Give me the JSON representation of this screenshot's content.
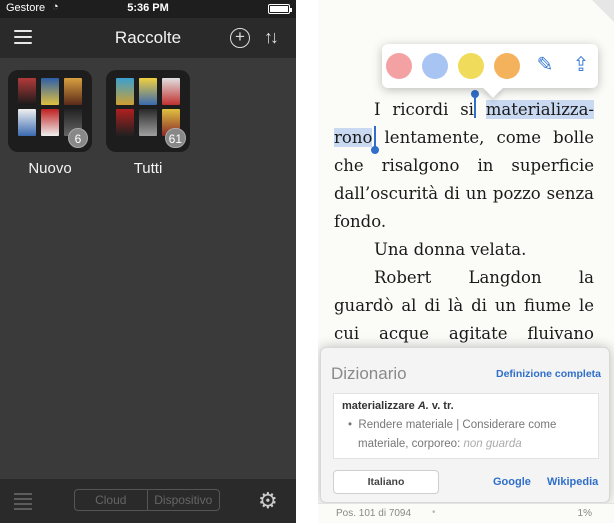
{
  "left": {
    "status": {
      "carrier": "Gestore",
      "time": "5:36 PM"
    },
    "nav": {
      "title": "Raccolte"
    },
    "collections": [
      {
        "label": "Nuovo",
        "count": "6"
      },
      {
        "label": "Tutti",
        "count": "61"
      }
    ],
    "bottom": {
      "segments": [
        "Cloud",
        "Dispositivo"
      ]
    },
    "colors": {
      "background": "#3a3a3a",
      "bars": "#2a2a2a",
      "tile": "#1d1d1d"
    }
  },
  "right": {
    "popup": {
      "swatches": [
        "#f4a1a3",
        "#a7c4f2",
        "#f0dc5a",
        "#f4b25c"
      ],
      "icons": [
        "edit-note-icon",
        "share-icon"
      ]
    },
    "text": {
      "p1_before": "I ricordi si ",
      "p1_hl_a": "materializza-",
      "p1_hl_b": "rono",
      "p1_after": " lentamente, come bolle che risalgono in superficie dall’oscurità di un pozzo senza fondo.",
      "p2": "Una donna velata.",
      "p3": "Robert Langdon la guardò al di là di un fiume le cui acque agitate fluivano rosse di sangue. Sulla riva opposta"
    },
    "dictionary": {
      "title": "Dizionario",
      "full_link": "Definizione completa",
      "headword": "materializzare",
      "grammar": "A.",
      "pos": "v. tr.",
      "definition": "Rendere materiale | Considerare come materiale, corporeo: ",
      "example": "non guarda",
      "language_button": "Italiano",
      "google": "Google",
      "wikipedia": "Wikipedia"
    },
    "footer": {
      "position": "Pos. 101 di 7094",
      "percent": "1%"
    },
    "colors": {
      "highlight": "#c9d9f2",
      "accent": "#2f6fc9"
    }
  }
}
